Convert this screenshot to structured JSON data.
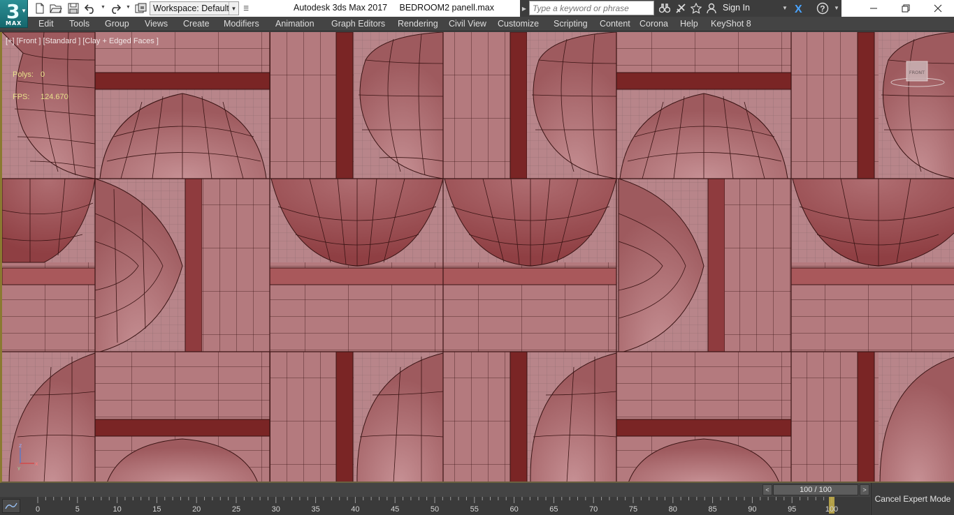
{
  "app": {
    "logo_number": "3",
    "logo_text": "MAX",
    "workspace_label": "Workspace: Default",
    "window_title": "Autodesk 3ds Max 2017     BEDROOM2 panell.max",
    "search_placeholder": "Type a keyword or phrase",
    "sign_in_label": "Sign In"
  },
  "quick_access_icons": [
    "new-file-icon",
    "open-folder-icon",
    "save-icon",
    "undo-icon",
    "redo-icon",
    "project-folder-icon"
  ],
  "titlebar_icons": [
    "binoculars-icon",
    "communication-center-icon",
    "favorites-star-icon",
    "user-icon",
    "exchange-apps-icon",
    "help-icon"
  ],
  "window_controls": [
    "minimize-icon",
    "restore-icon",
    "close-icon"
  ],
  "menu": [
    {
      "label": "Edit"
    },
    {
      "label": "Tools"
    },
    {
      "label": "Group"
    },
    {
      "label": "Views"
    },
    {
      "label": "Create"
    },
    {
      "label": "Modifiers"
    },
    {
      "label": "Animation"
    },
    {
      "label": "Graph Editors"
    },
    {
      "label": "Rendering"
    },
    {
      "label": "Civil View"
    },
    {
      "label": "Customize"
    },
    {
      "label": "Scripting"
    },
    {
      "label": "Content"
    },
    {
      "label": "Corona"
    },
    {
      "label": "Help"
    },
    {
      "label": "KeyShot 8"
    }
  ],
  "viewport": {
    "label": "[+] [Front ] [Standard ] [Clay + Edged Faces ]",
    "polys_label": "Polys:",
    "polys_value": "0",
    "fps_label": "FPS:",
    "fps_value": "124.670",
    "viewcube_face": "FRONT",
    "axis_z": "z",
    "axis_x": "x",
    "axis_y": "y",
    "colors": {
      "clay": "#b57f82",
      "clay_dark": "#8c3a3a",
      "stripe": "#7a2222",
      "edge": "#3a1414"
    }
  },
  "timeline": {
    "time_slider_value": "100 / 100",
    "prev_label": "<",
    "next_label": ">",
    "ticks": [
      "0",
      "5",
      "10",
      "15",
      "20",
      "25",
      "30",
      "35",
      "40",
      "45",
      "50",
      "55",
      "60",
      "65",
      "70",
      "75",
      "80",
      "85",
      "90",
      "95",
      "100"
    ],
    "cancel_expert_label": "Cancel Expert Mode"
  }
}
